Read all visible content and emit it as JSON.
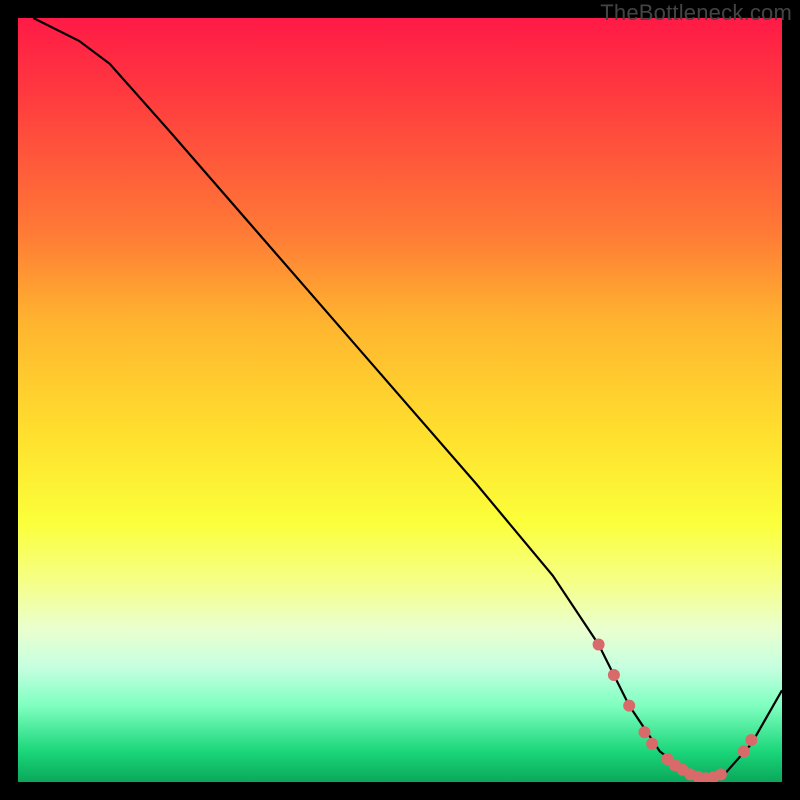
{
  "watermark": "TheBottleneck.com",
  "chart_data": {
    "type": "line",
    "title": "",
    "xlabel": "",
    "ylabel": "",
    "xlim": [
      0,
      100
    ],
    "ylim": [
      0,
      100
    ],
    "grid": false,
    "legend": false,
    "curve": {
      "x": [
        2,
        4,
        8,
        12,
        20,
        30,
        40,
        50,
        60,
        70,
        76,
        80,
        84,
        88,
        92,
        96,
        100
      ],
      "y": [
        100,
        99,
        97,
        94,
        85,
        73.5,
        62,
        50.5,
        39,
        27,
        18,
        10,
        4,
        1,
        0.5,
        5,
        12
      ]
    },
    "markers": {
      "x": [
        76,
        78,
        80,
        82,
        83,
        85,
        86,
        87,
        88,
        89,
        90,
        91,
        92,
        95,
        96
      ],
      "y": [
        18,
        14,
        10,
        6.5,
        5,
        3,
        2.2,
        1.6,
        1,
        0.7,
        0.5,
        0.6,
        1,
        4,
        5.5
      ]
    },
    "colors": {
      "line": "#000000",
      "marker": "#d86a6a"
    }
  }
}
